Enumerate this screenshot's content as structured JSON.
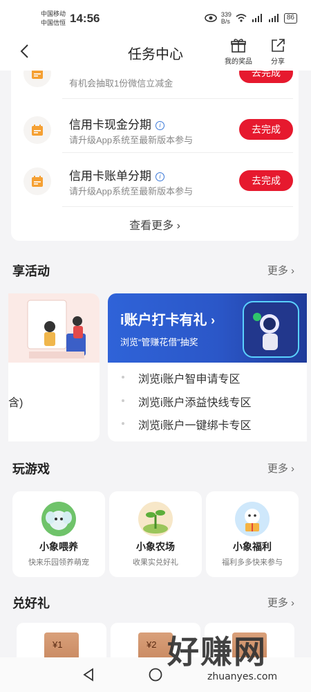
{
  "status_bar": {
    "carrier1": "中国移动",
    "carrier2": "中国信恒",
    "time": "14:56",
    "net_speed": "339\nB/s",
    "battery": "86"
  },
  "navbar": {
    "title": "任务中心",
    "prizes_label": "我的奖品",
    "share_label": "分享"
  },
  "tasks": [
    {
      "title": "",
      "subtitle": "有机会抽取1份微信立减金",
      "button": "去完成",
      "icon": "calendar-icon"
    },
    {
      "title": "信用卡现金分期",
      "subtitle": "请升级App系统至最新版本参与",
      "button": "去完成",
      "icon": "calendar-icon"
    },
    {
      "title": "信用卡账单分期",
      "subtitle": "请升级App系统至最新版本参与",
      "button": "去完成",
      "icon": "calendar-icon"
    }
  ],
  "see_more": "查看更多",
  "sections": {
    "activities": {
      "title": "享活动",
      "more": "更多"
    },
    "games": {
      "title": "玩游戏",
      "more": "更多"
    },
    "gifts": {
      "title": "兑好礼",
      "more": "更多"
    }
  },
  "promo_left": {
    "partial_text": "含)"
  },
  "promo_right": {
    "title": "i账户打卡有礼",
    "subtitle": "浏览“管赚花借”抽奖",
    "bullets": [
      "浏览i账户智申请专区",
      "浏览i账户添益快线专区",
      "浏览i账户一键绑卡专区"
    ]
  },
  "games": [
    {
      "name": "小象喂养",
      "desc": "快来乐园领养萌宠"
    },
    {
      "name": "小象农场",
      "desc": "收果实兑好礼"
    },
    {
      "name": "小象福利",
      "desc": "福利多多快来参与"
    }
  ],
  "gifts": [
    {
      "label": "¥1"
    },
    {
      "label": "¥2"
    },
    {
      "label": ""
    }
  ],
  "watermark": {
    "text": "好赚网",
    "url": "zhuanyes.com"
  },
  "colors": {
    "accent": "#e6192e",
    "icon_orange": "#f5a033",
    "promo_blue": "#2f63d8"
  }
}
